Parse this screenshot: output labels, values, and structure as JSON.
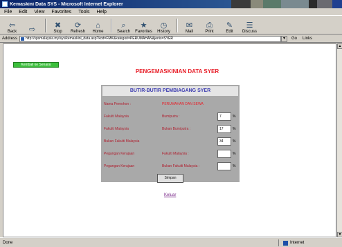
{
  "window": {
    "title": "Kemaskini Data SYS - Microsoft Internet Explorer",
    "menu": [
      "File",
      "Edit",
      "View",
      "Favorites",
      "Tools",
      "Help"
    ]
  },
  "toolbar": {
    "buttons": [
      {
        "label": "Back",
        "icon": "back-arrow-icon",
        "glyph": "⇦"
      },
      {
        "label": "",
        "icon": "forward-arrow-icon",
        "glyph": "⇨"
      },
      {
        "label": "Stop",
        "icon": "stop-icon",
        "glyph": "✖"
      },
      {
        "label": "Refresh",
        "icon": "refresh-icon",
        "glyph": "⟳"
      },
      {
        "label": "Home",
        "icon": "home-icon",
        "glyph": "⌂"
      },
      {
        "label": "Search",
        "icon": "search-icon",
        "glyph": "⌕"
      },
      {
        "label": "Favorites",
        "icon": "favorites-icon",
        "glyph": "★"
      },
      {
        "label": "History",
        "icon": "history-icon",
        "glyph": "◷"
      },
      {
        "label": "Mail",
        "icon": "mail-icon",
        "glyph": "✉"
      },
      {
        "label": "Print",
        "icon": "print-icon",
        "glyph": "⎙"
      },
      {
        "label": "Edit",
        "icon": "edit-icon",
        "glyph": "✎"
      },
      {
        "label": "Discuss",
        "icon": "discuss-icon",
        "glyph": "☰"
      }
    ]
  },
  "address": {
    "label": "Address",
    "url": "http://spsmalaysia.my/sys/kemaskini_data.asp?kod=FMK&kategori=PERUMAHAN&jenis=SYER",
    "go": "Go",
    "links": "Links"
  },
  "page": {
    "back_button": "Kembali ke Senarai",
    "title": "PENGEMASKINIAN DATA SYER",
    "panel_title": "BUTIR-BUTIR PEMBIAGANG SYER",
    "rows": [
      {
        "col1": "Nama Pemohon :",
        "col2": "PERUMAHAN DAN SEWA"
      },
      {
        "col1": "Fakulti Malaysia",
        "col2": "Bumiputra :",
        "value": "7",
        "unit": "%"
      },
      {
        "col1": "Fakulti Malaysia",
        "col2": "Bukan Bumiputra :",
        "value": "17",
        "unit": "%"
      },
      {
        "col1": "Bukan Fakulti Malaysia",
        "col2": "",
        "value": "34",
        "unit": "%"
      },
      {
        "col1": "Pegangan Kerajaan",
        "col2": "Fakulti Malaysia :",
        "value": "",
        "unit": "%"
      },
      {
        "col1": "Pegangan Kerajaan",
        "col2": "Bukan Fakulti Malaysia :",
        "value": "",
        "unit": "%"
      }
    ],
    "submit": "Simpan",
    "link": "Keluar"
  },
  "status": {
    "text": "Done",
    "zone": "Internet"
  },
  "colors": {
    "title_red": "#e8202a",
    "label_red": "#b02030",
    "panel_grey": "#a9a9a9",
    "header_blue": "#3a3ab0",
    "green_button": "#3bbf3b"
  }
}
